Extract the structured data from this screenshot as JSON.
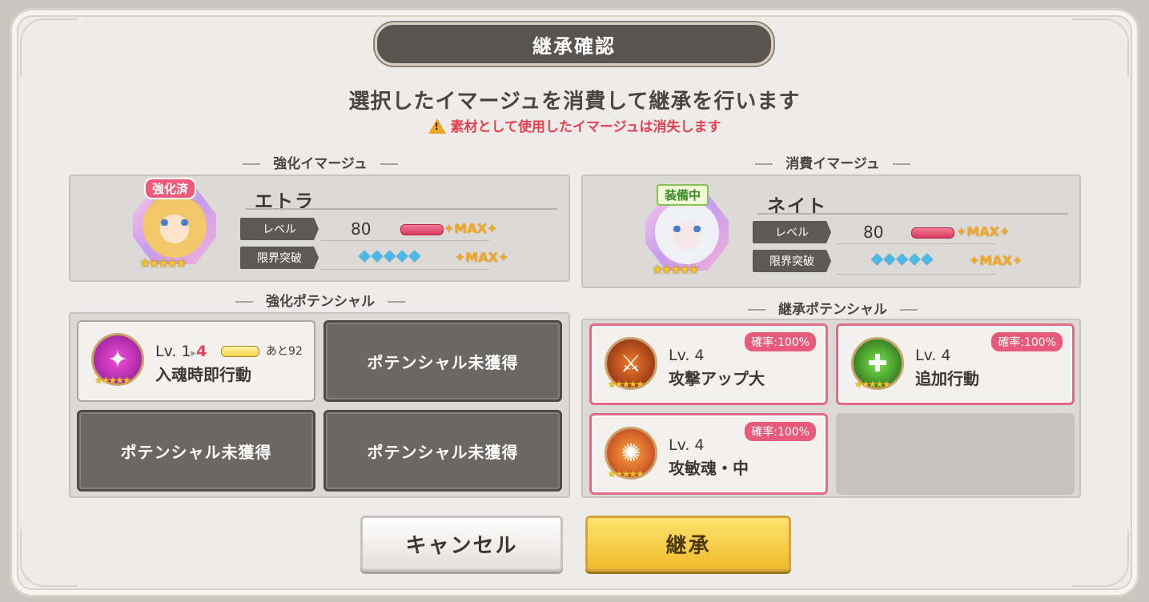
{
  "dialog": {
    "title": "継承確認",
    "subtitle": "選択したイマージュを消費して継承を行います",
    "warning": "素材として使用したイマージュは消失します"
  },
  "left": {
    "section_label": "強化イマージュ",
    "tag": "強化済",
    "name": "エトラ",
    "level_label": "レベル",
    "level_value": "80",
    "level_max": "✦MAX✦",
    "limit_label": "限界突破",
    "limit_max": "✦MAX✦",
    "stars": "★★★★★",
    "gems": "◆◆◆◆◆"
  },
  "right": {
    "section_label": "消費イマージュ",
    "tag": "装備中",
    "name": "ネイト",
    "level_label": "レベル",
    "level_value": "80",
    "level_max": "✦MAX✦",
    "limit_label": "限界突破",
    "limit_max": "✦MAX✦",
    "stars": "★★★★★",
    "gems": "◆◆◆◆◆"
  },
  "enhance_potential": {
    "section_label": "強化ポテンシャル",
    "owned": {
      "lv_prefix": "Lv. 1",
      "arrow": "▸",
      "lv_after": "4",
      "remain": "あと92",
      "name": "入魂時即行動",
      "stars": "★★★★★"
    },
    "empty_label": "ポテンシャル未獲得"
  },
  "inherit_potential": {
    "section_label": "継承ポテンシャル",
    "items": [
      {
        "lv": "Lv. 4",
        "name": "攻撃アップ大",
        "rate": "確率:100%",
        "stars": "★★★★★"
      },
      {
        "lv": "Lv. 4",
        "name": "追加行動",
        "rate": "確率:100%",
        "stars": "★★★★★"
      },
      {
        "lv": "Lv. 4",
        "name": "攻敏魂・中",
        "rate": "確率:100%",
        "stars": "★★★★★"
      }
    ]
  },
  "buttons": {
    "cancel": "キャンセル",
    "confirm": "継承"
  }
}
